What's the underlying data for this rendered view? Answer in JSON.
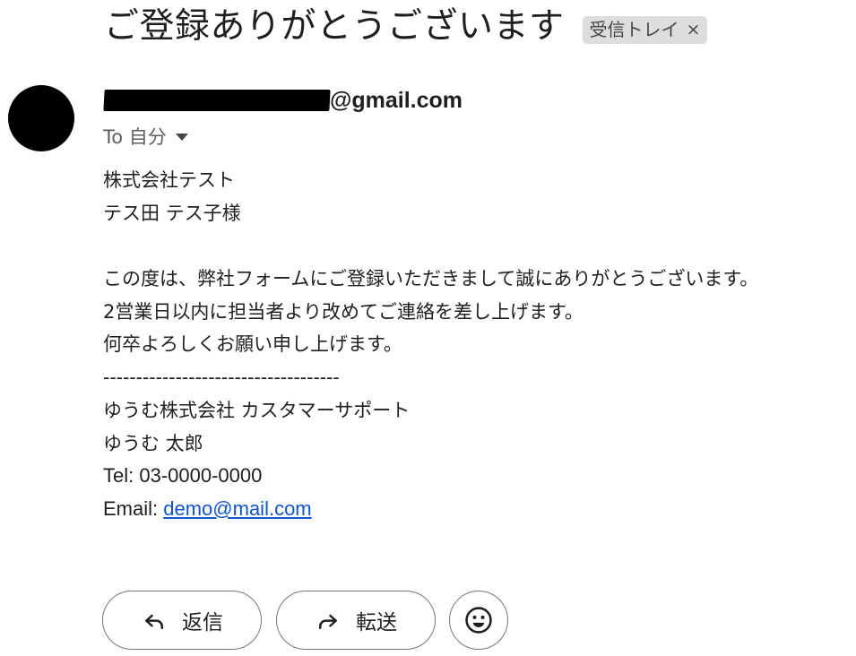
{
  "email": {
    "subject": "ご登録ありがとうございます",
    "label": "受信トレイ",
    "label_close": "×",
    "sender_visible": "@gmail.com",
    "recipient": "To 自分",
    "body_lines": [
      "株式会社テスト",
      "テス田 テス子様",
      "",
      "この度は、弊社フォームにご登録いただきまして誠にありがとうございます。",
      "2営業日以内に担当者より改めてご連絡を差し上げます。",
      "何卒よろしくお願い申し上げます。",
      "------------------------------------",
      "ゆうむ株式会社 カスタマーサポート",
      "ゆうむ 太郎",
      "Tel: 03-0000-0000"
    ],
    "email_label": "Email:",
    "email_link": "demo@mail.com"
  },
  "actions": {
    "reply_label": "返信",
    "forward_label": "転送"
  },
  "icons": {
    "avatar": "avatar",
    "reply": "reply-arrow-icon",
    "forward": "forward-arrow-icon",
    "emoji": "emoji-smile-icon",
    "caret": "caret-down-icon"
  }
}
